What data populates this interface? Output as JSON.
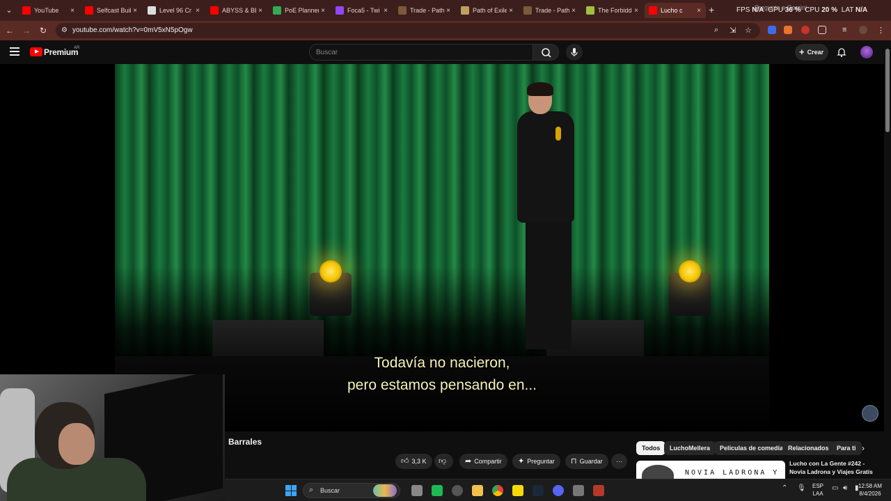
{
  "browser": {
    "tabs": [
      {
        "title": "YouTube",
        "favicon": "youtube-icon",
        "color": "#ff0000"
      },
      {
        "title": "Selfcast Buil",
        "favicon": "youtube-icon",
        "color": "#ff0000"
      },
      {
        "title": "Level 96 Cr",
        "favicon": "page-icon",
        "color": "#dddddd"
      },
      {
        "title": "ABYSS & BE",
        "favicon": "youtube-icon",
        "color": "#ff0000"
      },
      {
        "title": "PoE Planner",
        "favicon": "poe-planner-icon",
        "color": "#33aa55"
      },
      {
        "title": "Foca5 - Twi",
        "favicon": "twitch-icon",
        "color": "#9146ff"
      },
      {
        "title": "Trade - Path",
        "favicon": "poe-icon",
        "color": "#7a5a3a"
      },
      {
        "title": "Path of Exile",
        "favicon": "poe-icon",
        "color": "#c0a060"
      },
      {
        "title": "Trade - Path",
        "favicon": "poe-icon",
        "color": "#7a5a3a"
      },
      {
        "title": "The Forbidd",
        "favicon": "web-icon",
        "color": "#a0c040"
      },
      {
        "title": "Lucho c",
        "favicon": "youtube-icon",
        "color": "#ff0000",
        "active": true
      }
    ],
    "perf": {
      "fps_label": "FPS",
      "fps_value": "N/A",
      "cpu_label": "CPU",
      "cpu_value": "20 %",
      "gpu_label": "GPU",
      "gpu_value": "36 %",
      "lat_label": "LAT",
      "lat_value": "N/A"
    },
    "gemini_label": "Pregunta a Gemini",
    "url": "youtube.com/watch?v=0mV5xN5pOgw"
  },
  "youtube": {
    "brand": "Premium",
    "country": "AR",
    "search_placeholder": "Buscar",
    "create_label": "Crear"
  },
  "video": {
    "subtitle_line1": "Todavía no nacieron,",
    "subtitle_line2": "pero estamos pensando en...",
    "title_partial": "Barrales",
    "likes": "3,3 K",
    "actions": {
      "share": "Compartir",
      "ask": "Preguntar",
      "save": "Guardar"
    }
  },
  "chips": [
    "Todos",
    "LuchoMellera",
    "Películas de comedia",
    "Relacionados",
    "Para ti"
  ],
  "related": {
    "thumb_text": "NOVIA LADRONA Y",
    "title": "Lucho con La Gente #242 - Novia Ladrona y Viajes Gratis"
  },
  "taskbar": {
    "search_label": "Buscar",
    "lang_line1": "ESP",
    "lang_line2": "LAA",
    "time": "12:58 AM",
    "date": "8/4/2026"
  }
}
